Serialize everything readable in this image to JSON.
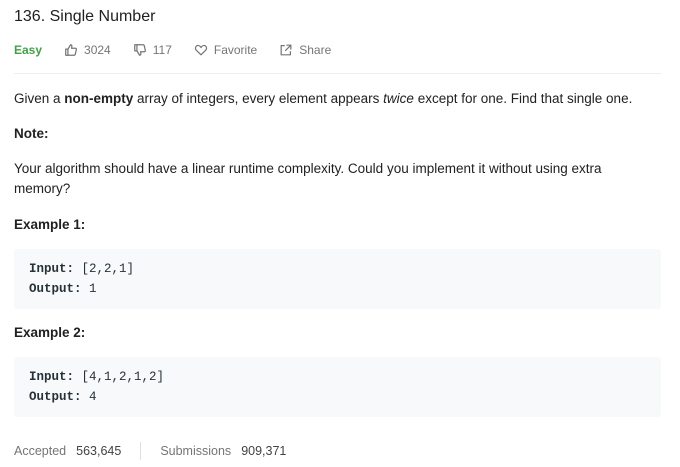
{
  "problem": {
    "title": "136. Single Number",
    "difficulty": "Easy",
    "likes": "3024",
    "dislikes": "117",
    "favorite_label": "Favorite",
    "share_label": "Share"
  },
  "description": {
    "p1_before": "Given a ",
    "p1_bold": "non-empty",
    "p1_mid": " array of integers, every element appears ",
    "p1_italic": "twice",
    "p1_after": " except for one. Find that single one.",
    "note_label": "Note:",
    "note_text": "Your algorithm should have a linear runtime complexity. Could you implement it without using extra memory?"
  },
  "examples": [
    {
      "title": "Example 1:",
      "input_label": "Input:",
      "input_value": "[2,2,1]",
      "output_label": "Output:",
      "output_value": "1"
    },
    {
      "title": "Example 2:",
      "input_label": "Input:",
      "input_value": "[4,1,2,1,2]",
      "output_label": "Output:",
      "output_value": "4"
    }
  ],
  "stats": {
    "accepted_label": "Accepted",
    "accepted_value": "563,645",
    "submissions_label": "Submissions",
    "submissions_value": "909,371"
  },
  "colors": {
    "easy": "#43a047",
    "code_background": "#f7f9fa",
    "muted_text": "#757575"
  }
}
